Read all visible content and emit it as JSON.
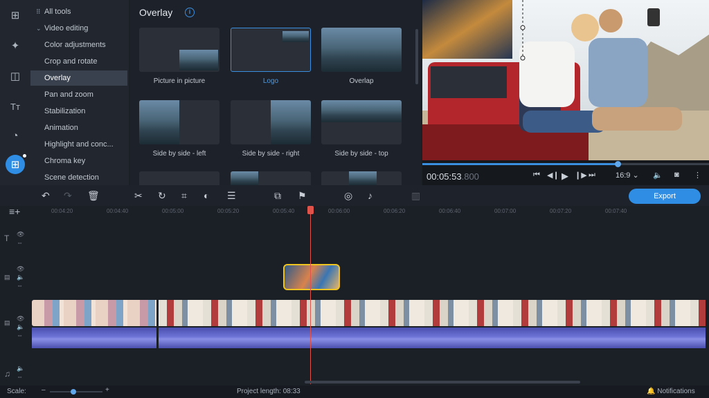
{
  "rail": {
    "items": [
      {
        "icon": "add-media-icon",
        "glyph": "⊞"
      },
      {
        "icon": "magic-wand-icon",
        "glyph": "✦"
      },
      {
        "icon": "transitions-icon",
        "glyph": "◫"
      },
      {
        "icon": "titles-icon",
        "glyph": "Tт"
      },
      {
        "icon": "stickers-icon",
        "glyph": "◔"
      },
      {
        "icon": "more-tools-icon",
        "glyph": "⊞",
        "active": true
      }
    ]
  },
  "tools": {
    "all_tools": "All tools",
    "video_editing": "Video editing",
    "items": [
      "Color adjustments",
      "Crop and rotate",
      "Overlay",
      "Pan and zoom",
      "Stabilization",
      "Animation",
      "Highlight and conc...",
      "Chroma key",
      "Scene detection"
    ],
    "selected": "Overlay"
  },
  "panel": {
    "title": "Overlay",
    "cards": [
      {
        "label": "Picture in picture",
        "selected": false
      },
      {
        "label": "Logo",
        "selected": true
      },
      {
        "label": "Overlap",
        "selected": false
      },
      {
        "label": "Side by side - left",
        "selected": false
      },
      {
        "label": "Side by side - right",
        "selected": false
      },
      {
        "label": "Side by side - top",
        "selected": false
      }
    ]
  },
  "preview": {
    "timecode_main": "00:05:53",
    "timecode_ms": ".800",
    "aspect": "16:9",
    "progress": 0.68,
    "controls": [
      "skip-start-icon",
      "frame-back-icon",
      "play-icon",
      "frame-forward-icon",
      "skip-end-icon"
    ]
  },
  "toolbar": {
    "export_label": "Export",
    "icons": [
      "undo-icon",
      "redo-icon",
      "delete-icon",
      "cut-icon",
      "rotate-icon",
      "crop-icon",
      "color-icon",
      "adjust-icon",
      "overlay-icon",
      "flag-icon",
      "record-icon",
      "mic-icon",
      "trim-icon"
    ]
  },
  "ruler": {
    "ticks": [
      "00:04:20",
      "00:04:40",
      "00:05:00",
      "00:05:20",
      "00:05:40",
      "00:06:00",
      "00:06:20",
      "00:06:40",
      "00:07:00",
      "00:07:20",
      "00:07:40"
    ]
  },
  "status": {
    "scale_label": "Scale:",
    "scale_value": 0.45,
    "project_length": "Project length: 08:33",
    "notifications": "Notifications"
  }
}
